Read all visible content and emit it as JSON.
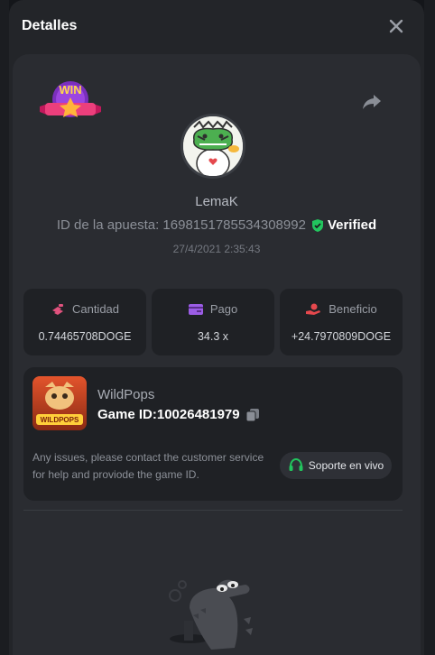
{
  "header": {
    "title": "Detalles"
  },
  "bet": {
    "username": "LemaK",
    "bet_id_label": "ID de la apuesta: 1698151785534308992",
    "verified_label": "Verified",
    "timestamp": "27/4/2021 2:35:43"
  },
  "stats": [
    {
      "label": "Cantidad",
      "value": "0.74465708DOGE",
      "icon": "coins-icon",
      "color": "#e0527e"
    },
    {
      "label": "Pago",
      "value": "34.3 x",
      "icon": "wallet-icon",
      "color": "#9b5de5"
    },
    {
      "label": "Beneficio",
      "value": "+24.7970809DOGE",
      "icon": "hand-coin-icon",
      "color": "#e5484d"
    }
  ],
  "game": {
    "name": "WildPops",
    "id_label": "Game ID:10026481979",
    "thumb_text": "WILDPOPS",
    "help_text": "Any issues, please contact the customer service for help and proviode the game ID.",
    "support_label": "Soporte en vivo"
  },
  "badge": {
    "text": "WIN"
  },
  "colors": {
    "verified": "#22c55e",
    "support_icon": "#22c55e",
    "modal_bg": "#232529",
    "card_bg": "#1f2125"
  }
}
